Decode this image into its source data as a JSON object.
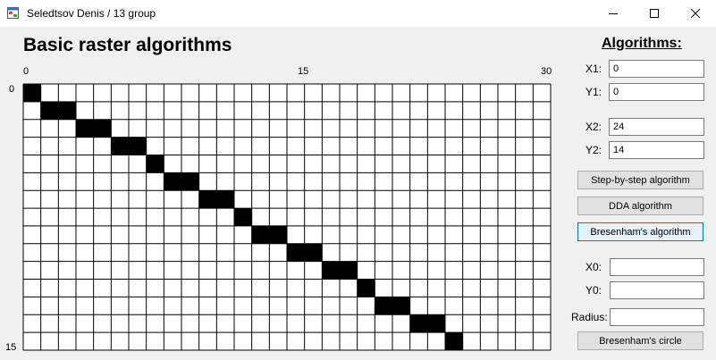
{
  "window": {
    "title": "Seledtsov Denis / 13 group",
    "icon": "app-form-icon",
    "controls": [
      "minimize-icon",
      "maximize-icon",
      "close-icon"
    ]
  },
  "heading": "Basic raster algorithms",
  "grid": {
    "columns": 30,
    "rows": 15,
    "x_axis_labels": [
      "0",
      "15",
      "30"
    ],
    "y_axis_labels": [
      "0",
      "15"
    ],
    "cell_color": "#ffffff",
    "fill_color": "#000000",
    "filled_cells": [
      [
        0,
        0
      ],
      [
        1,
        1
      ],
      [
        2,
        1
      ],
      [
        3,
        2
      ],
      [
        4,
        2
      ],
      [
        5,
        3
      ],
      [
        6,
        3
      ],
      [
        7,
        4
      ],
      [
        8,
        5
      ],
      [
        9,
        5
      ],
      [
        10,
        6
      ],
      [
        11,
        6
      ],
      [
        12,
        7
      ],
      [
        13,
        8
      ],
      [
        14,
        8
      ],
      [
        15,
        9
      ],
      [
        16,
        9
      ],
      [
        17,
        10
      ],
      [
        18,
        10
      ],
      [
        19,
        11
      ],
      [
        20,
        12
      ],
      [
        21,
        12
      ],
      [
        22,
        13
      ],
      [
        23,
        13
      ],
      [
        24,
        14
      ]
    ]
  },
  "panel": {
    "title": "Algorithms:",
    "fields": {
      "x1": {
        "label": "X1:",
        "value": "0"
      },
      "y1": {
        "label": "Y1:",
        "value": "0"
      },
      "x2": {
        "label": "X2:",
        "value": "24"
      },
      "y2": {
        "label": "Y2:",
        "value": "14"
      },
      "x0": {
        "label": "X0:",
        "value": ""
      },
      "y0": {
        "label": "Y0:",
        "value": ""
      },
      "radius": {
        "label": "Radius:",
        "value": ""
      }
    },
    "buttons": {
      "step": "Step-by-step algorithm",
      "dda": "DDA algorithm",
      "bresenham": "Bresenham's algorithm",
      "circle": "Bresenham's circle"
    },
    "active_button": "bresenham",
    "accent_color": "#0078d7"
  }
}
